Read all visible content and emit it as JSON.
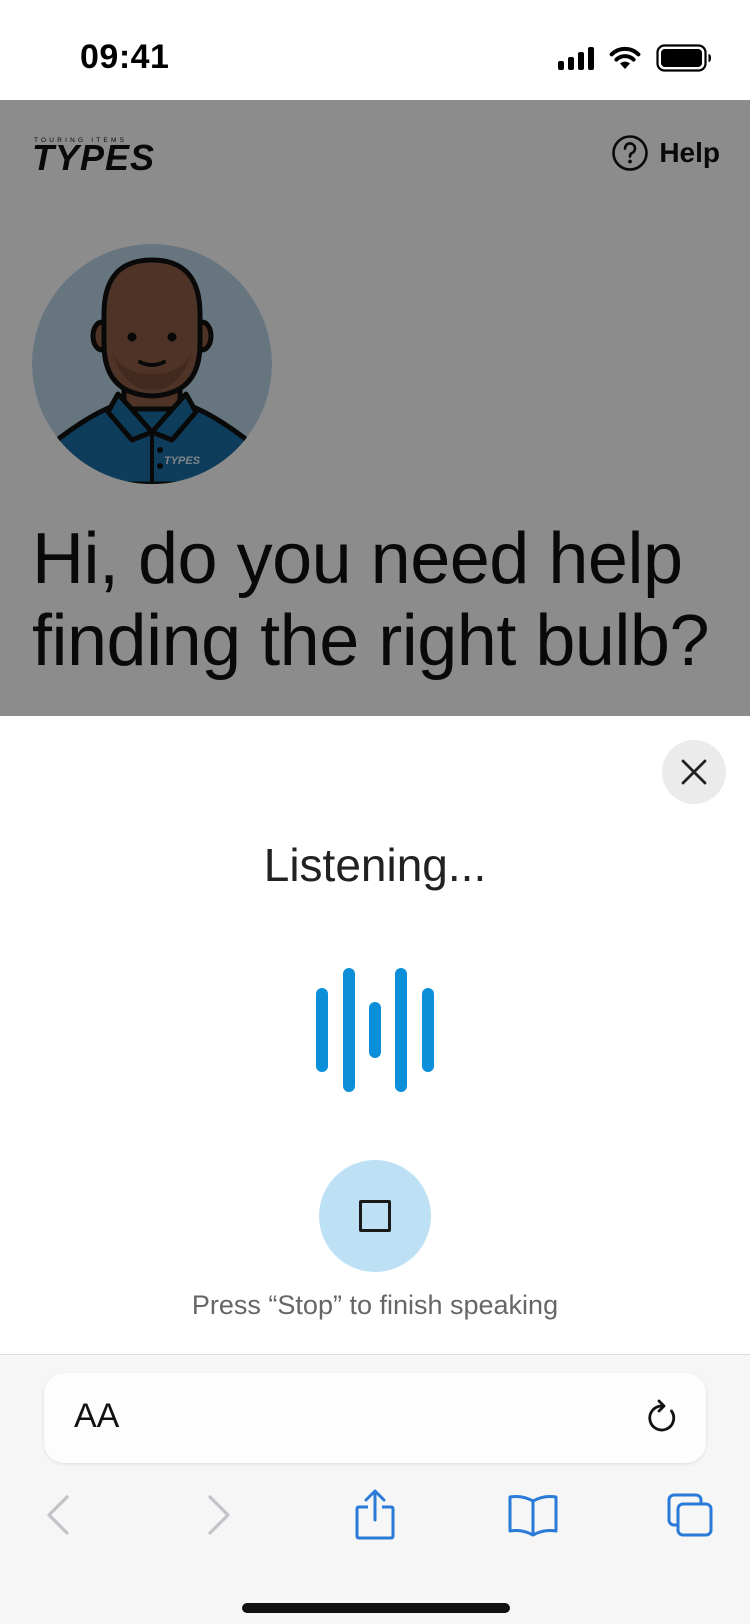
{
  "status_bar": {
    "time": "09:41"
  },
  "header": {
    "logo_text": "TYPES",
    "logo_tagline": "TOURING ITEMS",
    "help_label": "Help"
  },
  "hero": {
    "heading": "Hi, do you need help finding the right bulb?",
    "avatar_badge": "TYPES"
  },
  "listening_sheet": {
    "title": "Listening...",
    "stop_button_label": "Stop",
    "hint": "Press “Stop” to finish speaking"
  },
  "browser": {
    "text_size_label": "AA"
  },
  "colors": {
    "accent": "#0a8fd8",
    "stop_button_bg": "#bde0f5",
    "ios_blue": "#2a7bd8"
  },
  "icons": [
    "signal-icon",
    "wifi-icon",
    "battery-icon",
    "help-icon",
    "close-icon",
    "stop-icon",
    "reload-icon",
    "back-icon",
    "forward-icon",
    "share-icon",
    "bookmarks-icon",
    "tabs-icon"
  ]
}
